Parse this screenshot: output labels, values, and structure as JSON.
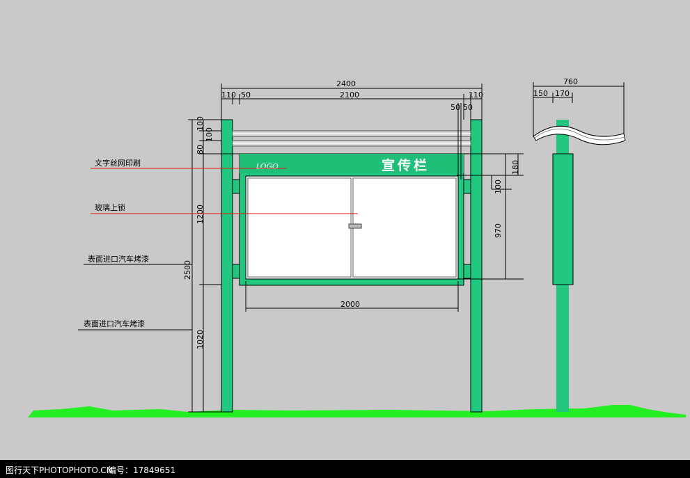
{
  "drawing": {
    "front_view": {
      "dimensions": {
        "total_width": "2400",
        "post_left": "110",
        "offset_left": "50",
        "inner_width": "2100",
        "post_right": "110",
        "offset_right_a": "50",
        "offset_right_b": "50",
        "glass_width": "2000",
        "top_bar_a": "100",
        "top_bar_b": "100",
        "gap": "80",
        "panel_height": "1200",
        "total_height": "2500",
        "base_height": "1020",
        "header_height": "180",
        "header_gap": "100",
        "glass_height": "970"
      },
      "header_title": "宣传栏",
      "logo_text": "LOGO"
    },
    "side_view": {
      "dimensions": {
        "total": "760",
        "left": "150",
        "mid": "170"
      }
    },
    "annotations": [
      "文字丝网印刷",
      "玻璃上锁",
      "表面进口汽车烤漆",
      "表面进口汽车烤漆"
    ],
    "colors": {
      "background": "#c9c9c9",
      "post_green": "#21c67f",
      "ground_green": "#22ee22",
      "dimension_line": "#000000",
      "leader_red": "#ee1111",
      "glass": "#ffffff"
    }
  },
  "footer": {
    "source": "图行天下PHOTOPHOTO.CN",
    "code": "编号：17849651"
  }
}
